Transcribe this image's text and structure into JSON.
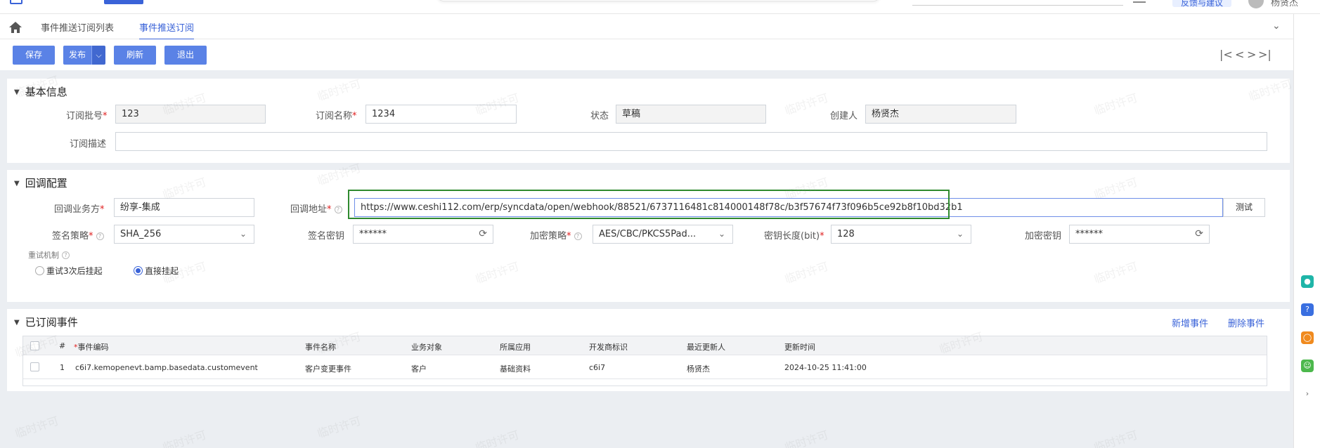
{
  "header": {
    "app_name": "…",
    "feedback_label": "反馈与建议",
    "user_name": "杨贤杰"
  },
  "tabs": [
    {
      "label": "事件推送订阅列表"
    },
    {
      "label": "事件推送订阅"
    }
  ],
  "toolbar": {
    "save": "保存",
    "publish": "发布",
    "refresh": "刷新",
    "exit": "退出",
    "pager": [
      "|<",
      "<",
      ">",
      ">|"
    ]
  },
  "basic": {
    "title": "基本信息",
    "batch_label": "订阅批号",
    "batch_value": "123",
    "name_label": "订阅名称",
    "name_value": "1234",
    "status_label": "状态",
    "status_value": "草稿",
    "creator_label": "创建人",
    "creator_value": "杨贤杰",
    "desc_label": "订阅描述",
    "desc_value": ""
  },
  "callback": {
    "title": "回调配置",
    "party_label": "回调业务方",
    "party_value": "纷享-集成",
    "url_label": "回调地址",
    "url_value": "https://www.ceshi112.com/erp/syncdata/open/webhook/88521/6737116481c814000148f78c/b3f57674f73f096b5ce92b8f10bd32b1",
    "test_label": "测试",
    "sign_policy_label": "签名策略",
    "sign_policy_value": "SHA_256",
    "sign_key_label": "签名密钥",
    "sign_key_value": "******",
    "encrypt_policy_label": "加密策略",
    "encrypt_policy_value": "AES/CBC/PKCS5Pad...",
    "key_length_label": "密钥长度(bit)",
    "key_length_value": "128",
    "encrypt_key_label": "加密密钥",
    "encrypt_key_value": "******",
    "retry_label": "重试机制",
    "retry_options": [
      {
        "label": "重试3次后挂起",
        "selected": false
      },
      {
        "label": "直接挂起",
        "selected": true
      }
    ]
  },
  "events": {
    "title": "已订阅事件",
    "add_label": "新增事件",
    "delete_label": "删除事件",
    "columns": [
      "#",
      "事件编码",
      "事件名称",
      "业务对象",
      "所属应用",
      "开发商标识",
      "最近更新人",
      "更新时间"
    ],
    "rows": [
      [
        "1",
        "c6i7.kemopenevt.bamp.basedata.customevent",
        "客户变更事件",
        "客户",
        "基础资料",
        "c6i7",
        "杨贤杰",
        "2024-10-25 11:41:00"
      ]
    ]
  },
  "watermark_text": "临时许可",
  "colors": {
    "primary": "#5a82e6",
    "link": "#3a63d8",
    "highlight_border": "#2f8a2f",
    "required": "#e02020"
  }
}
